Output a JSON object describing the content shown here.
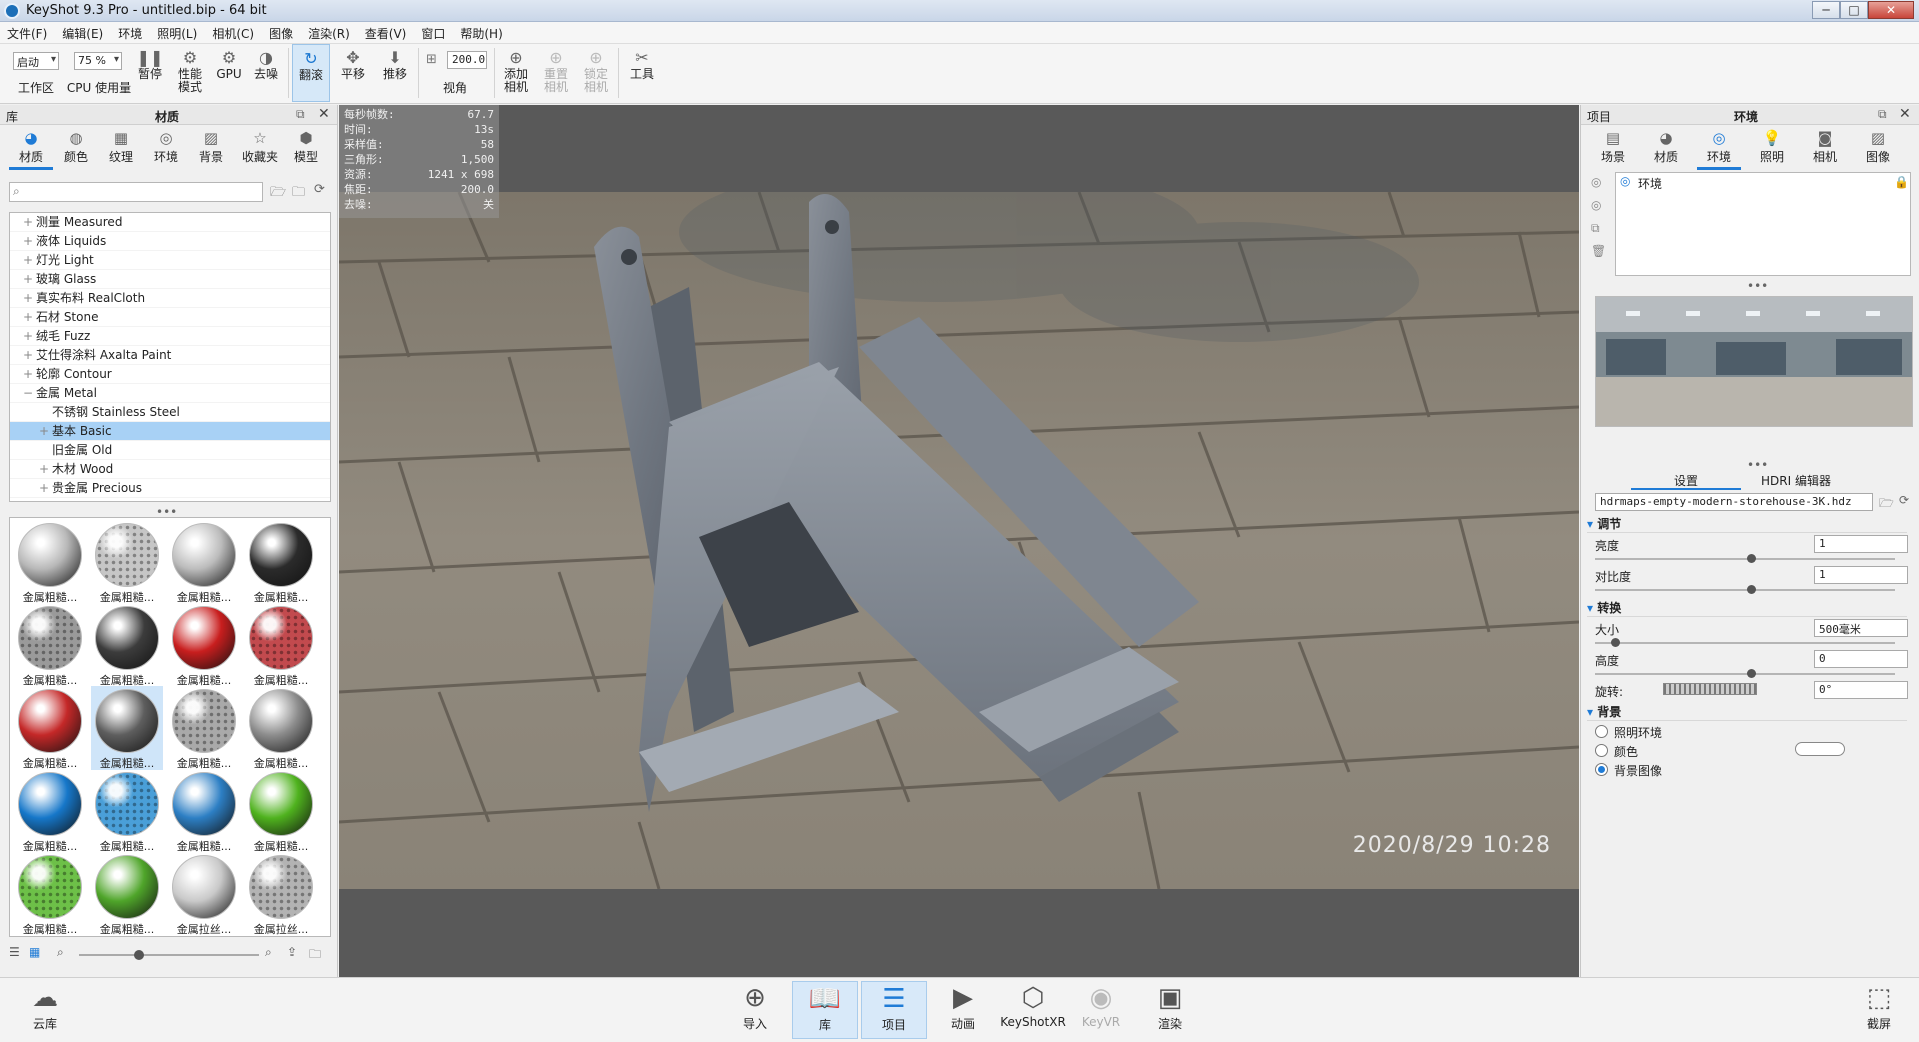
{
  "window": {
    "title": "KeyShot 9.3 Pro  - untitled.bip  - 64 bit",
    "minimize": "─",
    "maximize": "□",
    "close": "✕"
  },
  "menu": [
    "文件(F)",
    "编辑(E)",
    "环境",
    "照明(L)",
    "相机(C)",
    "图像",
    "渲染(R)",
    "查看(V)",
    "窗口",
    "帮助(H)"
  ],
  "toolbar": {
    "workspace_value": "启动",
    "workspace_label": "工作区",
    "cpu_value": "75 %",
    "cpu_label": "CPU 使用量",
    "pause": "暂停",
    "perf_mode_1": "性能",
    "perf_mode_2": "模式",
    "gpu": "GPU",
    "denoise": "去噪",
    "tumble": "翻滚",
    "pan": "平移",
    "dolly": "推移",
    "fov_value": "200.0",
    "fov_label": "视角",
    "add_camera_1": "添加",
    "add_camera_2": "相机",
    "reset_camera_1": "重置",
    "reset_camera_2": "相机",
    "lock_camera_1": "锁定",
    "lock_camera_2": "相机",
    "tools": "工具"
  },
  "library": {
    "header_left": "库",
    "header_title": "材质",
    "tabs": [
      "材质",
      "颜色",
      "纹理",
      "环境",
      "背景",
      "收藏夹",
      "模型"
    ],
    "tree": [
      {
        "label": "测量 Measured",
        "level": 1,
        "exp": "+"
      },
      {
        "label": "液体 Liquids",
        "level": 1,
        "exp": "+"
      },
      {
        "label": "灯光 Light",
        "level": 1,
        "exp": "+"
      },
      {
        "label": "玻璃 Glass",
        "level": 1,
        "exp": "+"
      },
      {
        "label": "真实布料 RealCloth",
        "level": 1,
        "exp": "+"
      },
      {
        "label": "石材 Stone",
        "level": 1,
        "exp": "+"
      },
      {
        "label": "绒毛 Fuzz",
        "level": 1,
        "exp": "+"
      },
      {
        "label": "艾仕得涂料 Axalta Paint",
        "level": 1,
        "exp": "+"
      },
      {
        "label": "轮廓 Contour",
        "level": 1,
        "exp": "+"
      },
      {
        "label": "金属 Metal",
        "level": 1,
        "exp": "−"
      },
      {
        "label": "不锈钢 Stainless Steel",
        "level": 2,
        "exp": ""
      },
      {
        "label": "基本 Basic",
        "level": 2,
        "exp": "+"
      },
      {
        "label": "旧金属 Old",
        "level": 2,
        "exp": ""
      },
      {
        "label": "木材 Wood",
        "level": 2,
        "exp": "+"
      },
      {
        "label": "贵金属 Precious",
        "level": 2,
        "exp": "+"
      }
    ],
    "thumbs": [
      {
        "label": "金属粗糙...",
        "color": "#b8b8b8"
      },
      {
        "label": "金属粗糙...",
        "color": "#c6c6c6"
      },
      {
        "label": "金属粗糙...",
        "color": "#bcbcbc"
      },
      {
        "label": "金属粗糙...",
        "color": "#2b2b2b"
      },
      {
        "label": "金属粗糙...",
        "color": "#9a9a9a"
      },
      {
        "label": "金属粗糙...",
        "color": "#3c3c3c"
      },
      {
        "label": "金属粗糙...",
        "color": "#c81e1e"
      },
      {
        "label": "金属粗糙...",
        "color": "#c24a4e"
      },
      {
        "label": "金属粗糙...",
        "color": "#c42828"
      },
      {
        "label": "金属粗糙...",
        "color": "#5e5e5e"
      },
      {
        "label": "金属粗糙...",
        "color": "#a9a9a9"
      },
      {
        "label": "金属粗糙...",
        "color": "#8d8d8d"
      },
      {
        "label": "金属粗糙...",
        "color": "#1677c9"
      },
      {
        "label": "金属粗糙...",
        "color": "#4a9fd8"
      },
      {
        "label": "金属粗糙...",
        "color": "#2d7fc4"
      },
      {
        "label": "金属粗糙...",
        "color": "#4fb21e"
      },
      {
        "label": "金属粗糙...",
        "color": "#6dc048"
      },
      {
        "label": "金属粗糙...",
        "color": "#4fa52a"
      },
      {
        "label": "金属拉丝...",
        "color": "#c9c9c9"
      },
      {
        "label": "金属拉丝...",
        "color": "#b3b3b3"
      }
    ]
  },
  "viewport": {
    "stats": [
      {
        "k": "每秒帧数:",
        "v": "67.7"
      },
      {
        "k": "时间:",
        "v": "13s"
      },
      {
        "k": "采样值:",
        "v": "58"
      },
      {
        "k": "三角形:",
        "v": "1,500"
      },
      {
        "k": "资源:",
        "v": "1241 x 698"
      },
      {
        "k": "焦距:",
        "v": "200.0"
      },
      {
        "k": "去噪:",
        "v": "关"
      }
    ],
    "timestamp": "2020/8/29  10:28"
  },
  "project": {
    "header_left": "项目",
    "header_title": "环境",
    "tabs": [
      "场景",
      "材质",
      "环境",
      "照明",
      "相机",
      "图像"
    ],
    "env_item": "环境",
    "subtabs": [
      "设置",
      "HDRI 编辑器"
    ],
    "hdri_file": "hdrmaps-empty-modern-storehouse-3K.hdz",
    "sec_adjust": "调节",
    "brightness_label": "亮度",
    "brightness_value": "1",
    "contrast_label": "对比度",
    "contrast_value": "1",
    "sec_transform": "转换",
    "size_label": "大小",
    "size_value": "500毫米",
    "height_label": "高度",
    "height_value": "0",
    "rotation_label": "旋转:",
    "rotation_value": "0°",
    "sec_background": "背景",
    "bg_lighting": "照明环境",
    "bg_color": "颜色",
    "bg_image": "背景图像"
  },
  "bottom": {
    "cloud": "云库",
    "items": [
      "导入",
      "库",
      "项目",
      "动画",
      "KeyShotXR",
      "KeyVR",
      "渲染"
    ],
    "screenshot": "截屏"
  }
}
